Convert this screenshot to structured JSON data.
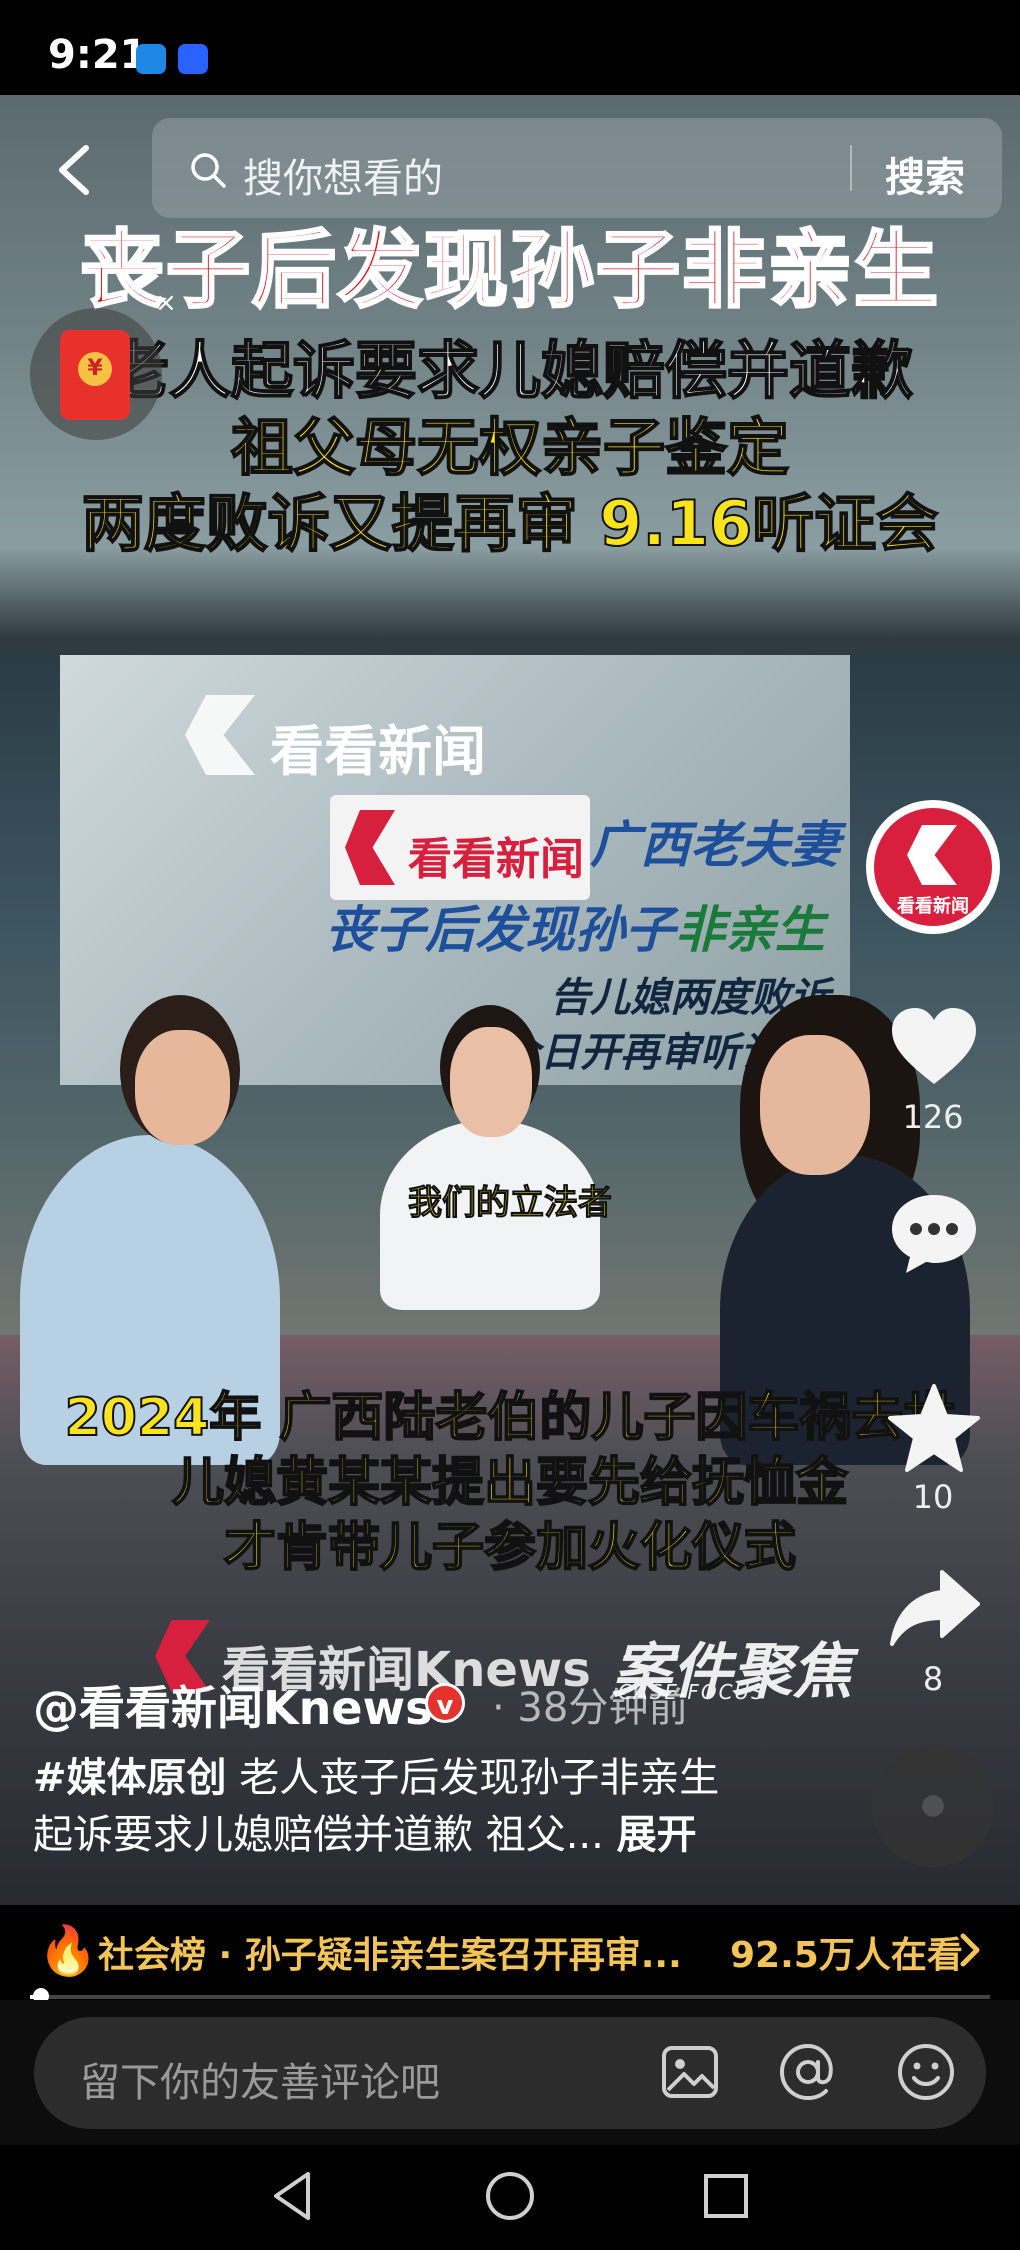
{
  "status_bar": {
    "time": "9:21"
  },
  "search": {
    "placeholder": "搜你想看的",
    "button_label": "搜索"
  },
  "video": {
    "headline_red": "丧子后发现孙子非亲生",
    "headline_white": "老人起诉要求儿媳赔偿并道歉",
    "headline_yellow_1": "祖父母无权亲子鉴定",
    "headline_yellow_2": "两度败诉又提再审  9.16听证会",
    "studio_logo": "看看新闻",
    "screen_line_1": "广西老夫妻",
    "screen_line_2a": "丧子后发现孙子",
    "screen_line_2b": "非亲生",
    "screen_line_3": "告儿媳两度败诉",
    "screen_line_4": "今日开再审听证会",
    "desk_plate": "看看新闻",
    "speech_subtitle": "我们的立法者",
    "caption_1": "2024年  广西陆老伯的儿子因车祸去世",
    "caption_2": "儿媳黄某某提出要先给抚恤金",
    "caption_3": "才肯带儿子参加火化仪式",
    "footer_brand": "看看新闻Knews",
    "footer_program": "案件聚焦",
    "footer_program_en": "CASE FOCUS"
  },
  "rail": {
    "avatar_label": "看看新闻",
    "likes": "126",
    "favorites": "10",
    "shares": "8"
  },
  "post": {
    "author": "@看看新闻Knews",
    "time_ago": "· 38分钟前",
    "hashtag": "#媒体原创",
    "desc_1": " 老人丧子后发现孙子非亲生",
    "desc_2": "起诉要求儿媳赔偿并道歉 祖父...",
    "expand_label": "展开"
  },
  "hot": {
    "text": "社会榜 · 孙子疑非亲生案召开再审...",
    "viewers": "92.5万人在看"
  },
  "progress": {
    "fraction": 0.005
  },
  "comment": {
    "placeholder": "留下你的友善评论吧"
  },
  "icons": {
    "back": "chevron-left-icon",
    "search": "search-icon",
    "like": "heart-icon",
    "comment": "comment-bubble-icon",
    "favorite": "star-icon",
    "share": "share-arrow-icon",
    "image": "image-icon",
    "mention": "at-icon",
    "emoji": "emoji-icon"
  },
  "colors": {
    "accent": "#d71f3e",
    "hot_text": "#f3c458",
    "caption_yellow": "#f8e31c"
  }
}
